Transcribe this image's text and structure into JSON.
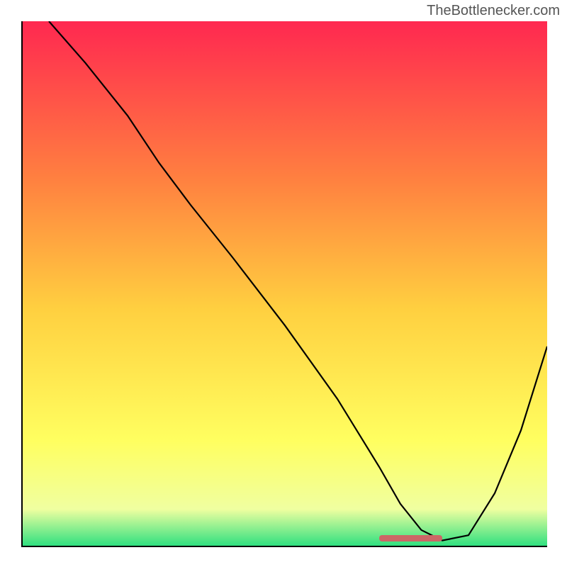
{
  "watermark": "TheBottlenecker.com",
  "chart_data": {
    "type": "line",
    "title": "",
    "xlabel": "",
    "ylabel": "",
    "xlim": [
      0,
      100
    ],
    "ylim": [
      0,
      100
    ],
    "grid": false,
    "gradient_background": {
      "top": "#ff2850",
      "mid_upper": "#ff8040",
      "mid": "#ffd040",
      "mid_lower": "#ffff60",
      "near_bottom": "#f0ffa0",
      "bottom": "#30e080"
    },
    "series": [
      {
        "name": "bottleneck-curve",
        "color": "#000000",
        "x": [
          5,
          12,
          20,
          26,
          32,
          40,
          50,
          60,
          68,
          72,
          76,
          80,
          85,
          90,
          95,
          100
        ],
        "y": [
          100,
          92,
          82,
          73,
          65,
          55,
          42,
          28,
          15,
          8,
          3,
          1,
          2,
          10,
          22,
          38
        ]
      }
    ],
    "annotations": [
      {
        "name": "optimal-zone-marker",
        "type": "bar",
        "color": "#cc6666",
        "x_start": 68,
        "x_end": 80,
        "y": 1.5
      }
    ]
  }
}
